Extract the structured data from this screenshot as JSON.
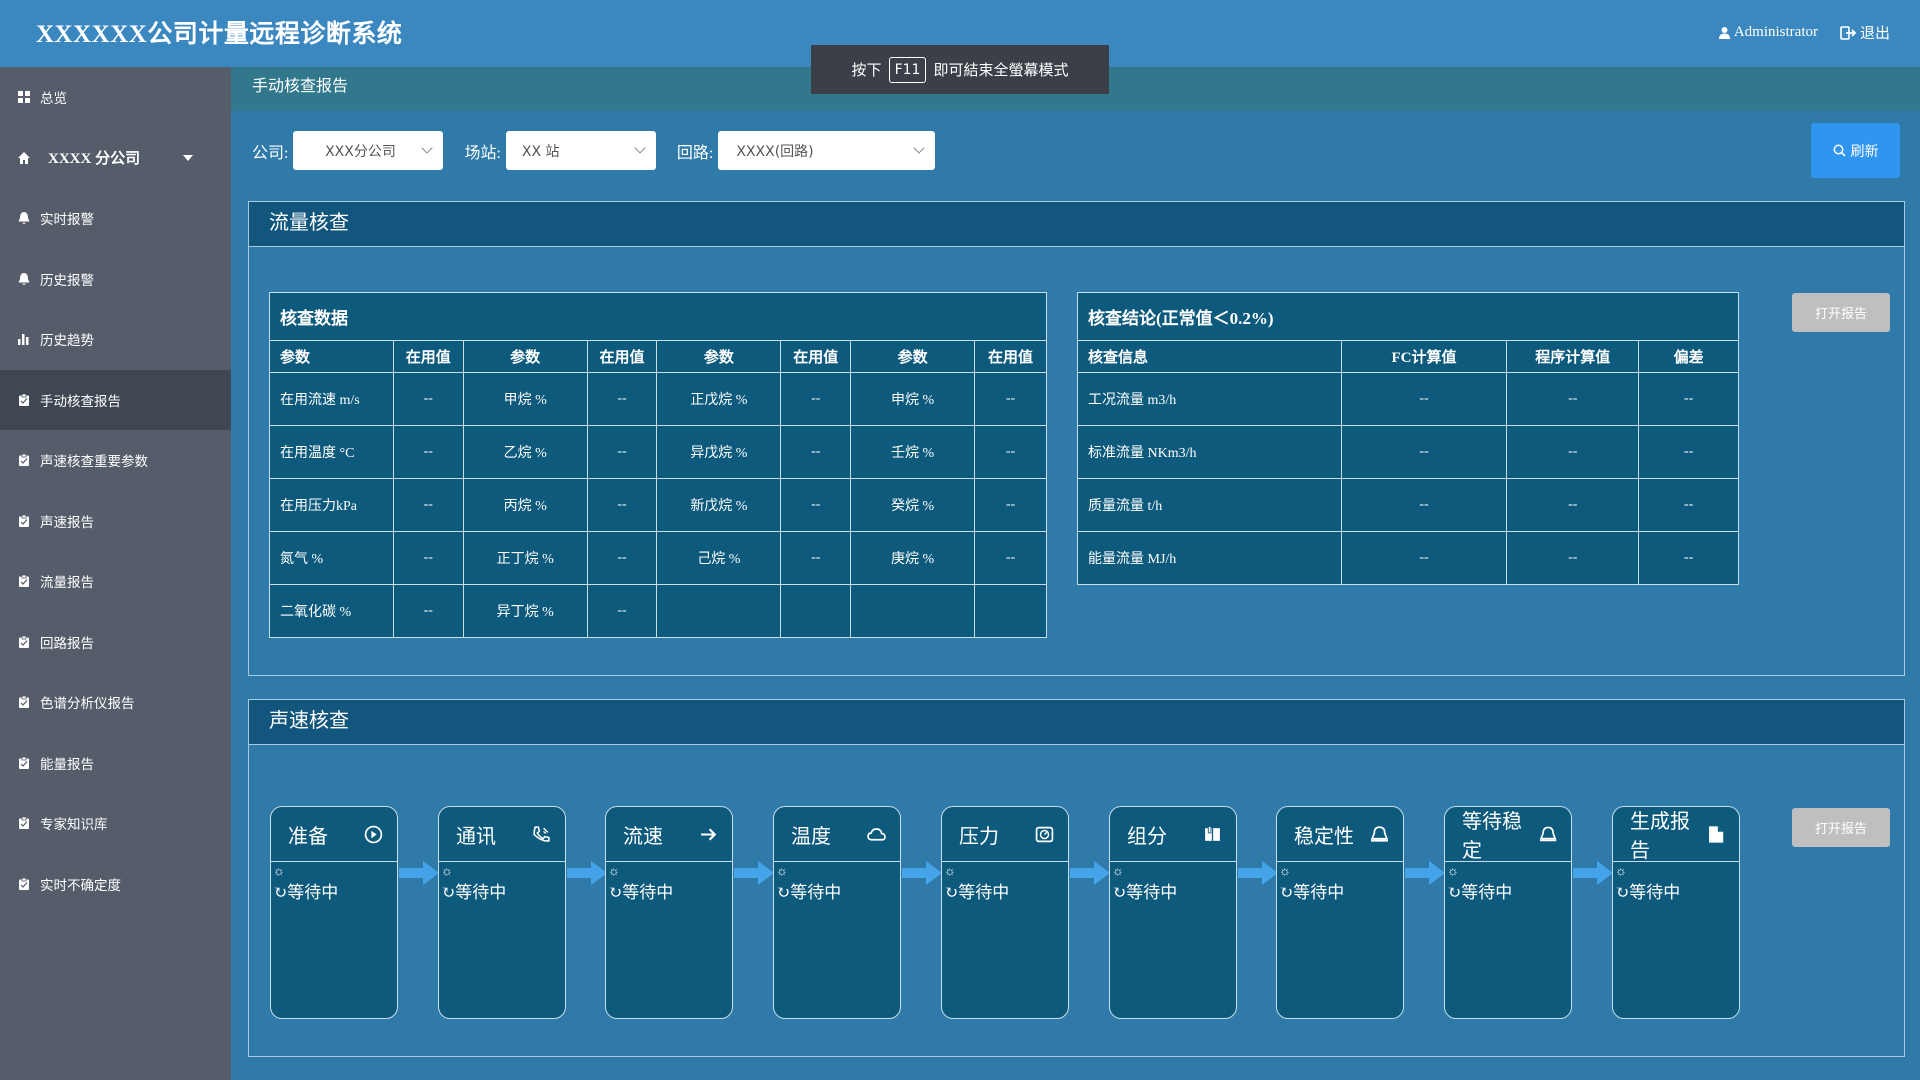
{
  "app": {
    "title": "XXXXXX公司计量远程诊断系统",
    "user": "Administrator",
    "logout": "退出",
    "fullscreen_tip": {
      "prefix": "按下",
      "key": "F11",
      "suffix": "即可結束全螢幕模式"
    }
  },
  "sidebar": {
    "items": [
      {
        "label": "总览",
        "icon": "grid-icon"
      },
      {
        "label": "XXXX 分公司",
        "icon": "home-icon"
      },
      {
        "label": "实时报警",
        "icon": "bell-icon"
      },
      {
        "label": "历史报警",
        "icon": "bell-icon"
      },
      {
        "label": "历史趋势",
        "icon": "bar-chart-icon"
      },
      {
        "label": "手动核查报告",
        "icon": "clipboard-icon"
      },
      {
        "label": "声速核查重要参数",
        "icon": "clipboard-icon"
      },
      {
        "label": "声速报告",
        "icon": "clipboard-icon"
      },
      {
        "label": "流量报告",
        "icon": "clipboard-icon"
      },
      {
        "label": "回路报告",
        "icon": "clipboard-icon"
      },
      {
        "label": "色谱分析仪报告",
        "icon": "clipboard-icon"
      },
      {
        "label": "能量报告",
        "icon": "clipboard-icon"
      },
      {
        "label": "专家知识库",
        "icon": "clipboard-icon"
      },
      {
        "label": "实时不确定度",
        "icon": "clipboard-icon"
      }
    ]
  },
  "page": {
    "title": "手动核查报告"
  },
  "filters": {
    "company_label": "公司:",
    "company_value": "XXX分公司",
    "station_label": "场站:",
    "station_value": "XX 站",
    "loop_label": "回路:",
    "loop_value": "XXXX(回路)",
    "refresh": "刷新"
  },
  "flow_check": {
    "title": "流量核查",
    "open_report": "打开报告",
    "data_table": {
      "caption": "核查数据",
      "headers": [
        "参数",
        "在用值",
        "参数",
        "在用值",
        "参数",
        "在用值",
        "参数",
        "在用值"
      ],
      "rows": [
        [
          "在用流速 m/s",
          "--",
          "甲烷 %",
          "--",
          "正戊烷 %",
          "--",
          "申烷 %",
          "--"
        ],
        [
          "在用温度 °C",
          "--",
          "乙烷 %",
          "--",
          "异戊烷 %",
          "--",
          "壬烷 %",
          "--"
        ],
        [
          "在用压力kPa",
          "--",
          "丙烷 %",
          "--",
          "新戊烷 %",
          "--",
          "癸烷 %",
          "--"
        ],
        [
          "氮气 %",
          "--",
          "正丁烷 %",
          "--",
          "己烷 %",
          "--",
          "庚烷 %",
          "--"
        ],
        [
          "二氧化碳 %",
          "--",
          "异丁烷 %",
          "--",
          "",
          "",
          "",
          ""
        ]
      ]
    },
    "conclusion_table": {
      "caption": "核查结论(正常值＜0.2%)",
      "headers": [
        "核查信息",
        "FC计算值",
        "程序计算值",
        "偏差"
      ],
      "rows": [
        [
          "工况流量 m3/h",
          "--",
          "--",
          "--"
        ],
        [
          "标准流量 NKm3/h",
          "--",
          "--",
          "--"
        ],
        [
          "质量流量 t/h",
          "--",
          "--",
          "--"
        ],
        [
          "能量流量 MJ/h",
          "--",
          "--",
          "--"
        ]
      ]
    }
  },
  "sound_check": {
    "title": "声速核查",
    "open_report": "打开报告",
    "steps": [
      {
        "label": "准备",
        "icon": "play-circle-icon",
        "status": "等待中"
      },
      {
        "label": "通讯",
        "icon": "phone-icon",
        "status": "等待中"
      },
      {
        "label": "流速",
        "icon": "arrow-right-icon",
        "status": "等待中"
      },
      {
        "label": "温度",
        "icon": "cloud-icon",
        "status": "等待中"
      },
      {
        "label": "压力",
        "icon": "gauge-icon",
        "status": "等待中"
      },
      {
        "label": "组分",
        "icon": "book-icon",
        "status": "等待中"
      },
      {
        "label": "稳定性",
        "icon": "bell-outline-icon",
        "status": "等待中"
      },
      {
        "label": "等待稳定",
        "icon": "bell-outline-icon",
        "status": "等待中"
      },
      {
        "label": "生成报告",
        "icon": "file-icon",
        "status": "等待中"
      }
    ]
  },
  "colors": {
    "header": "#3b88c0",
    "sidebar": "#545d69",
    "panel_head": "#12567d",
    "accent": "#2f95ef"
  }
}
